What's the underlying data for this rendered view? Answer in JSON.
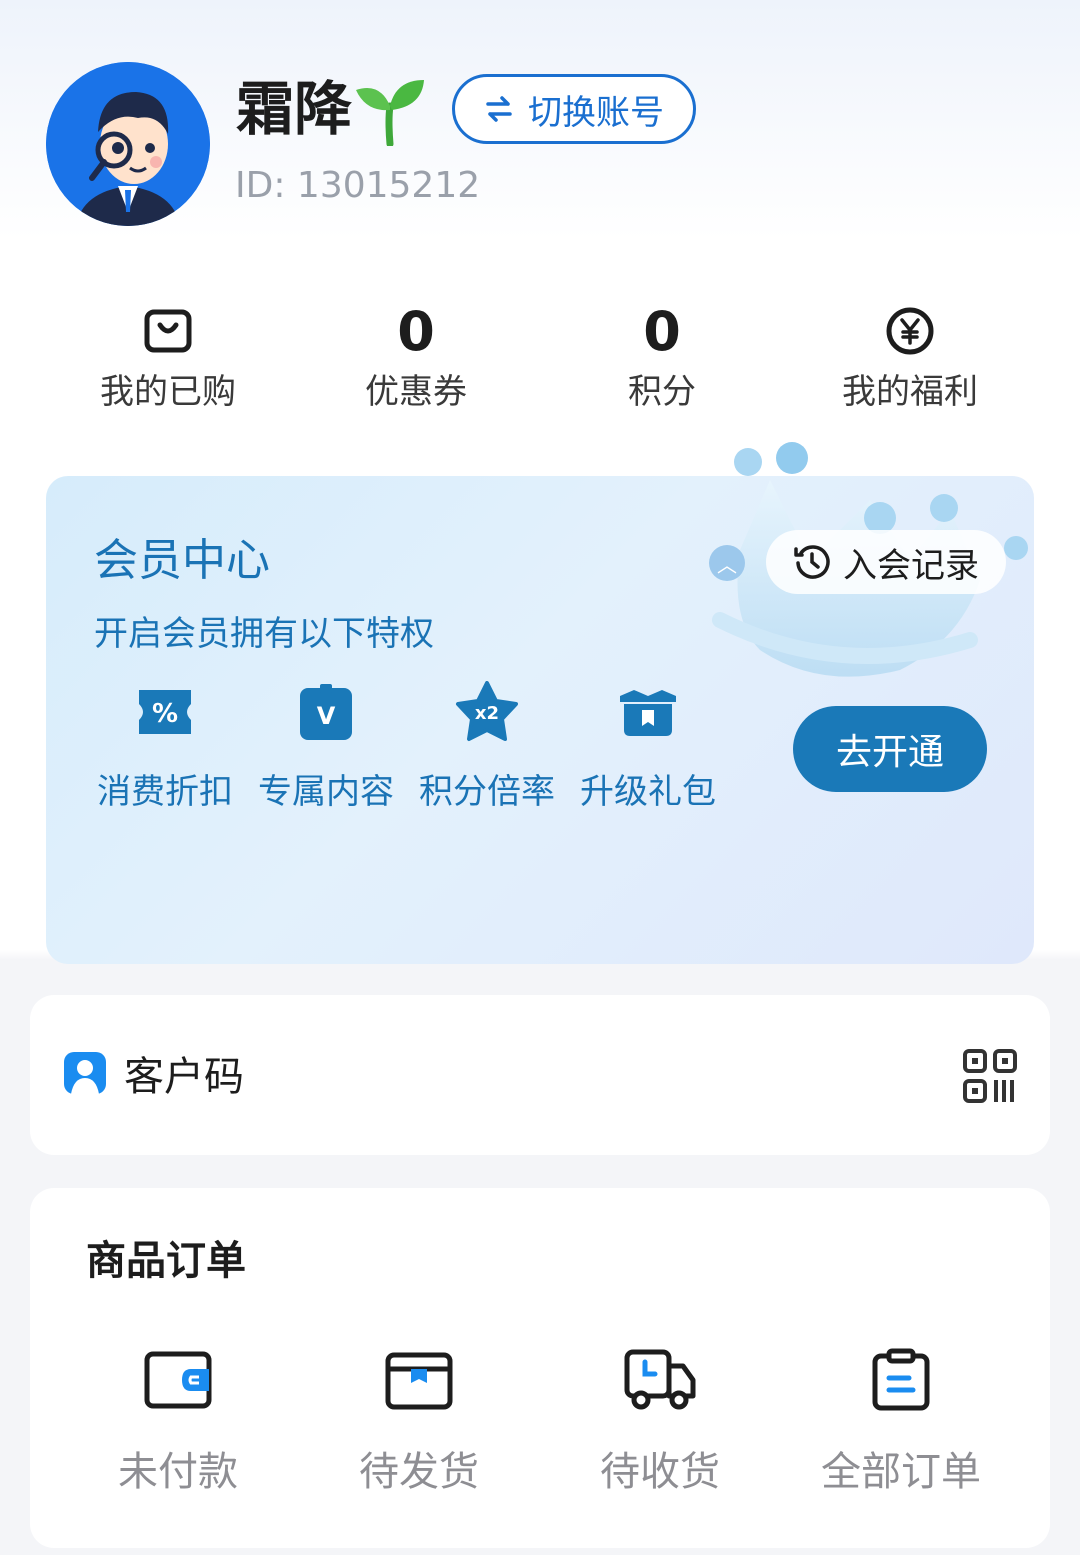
{
  "profile": {
    "name": "霜降",
    "id_text": "ID: 13015212",
    "switch_label": "切换账号"
  },
  "stats": [
    {
      "value": "",
      "icon": "bag-icon",
      "label": "我的已购"
    },
    {
      "value": "0",
      "label": "优惠券"
    },
    {
      "value": "0",
      "label": "积分"
    },
    {
      "value": "",
      "icon": "yen-circle-icon",
      "label": "我的福利"
    }
  ],
  "member": {
    "title": "会员中心",
    "subtitle": "开启会员拥有以下特权",
    "record_label": "入会记录",
    "open_label": "去开通",
    "perks": [
      {
        "label": "消费折扣",
        "icon": "discount-ticket-icon",
        "glyph": "%"
      },
      {
        "label": "专属内容",
        "icon": "exclusive-content-icon",
        "glyph": "V"
      },
      {
        "label": "积分倍率",
        "icon": "points-multiplier-icon",
        "glyph": "x2"
      },
      {
        "label": "升级礼包",
        "icon": "gift-box-icon",
        "glyph": ""
      }
    ],
    "accent_color": "#1a73b5"
  },
  "customer_code": {
    "label": "客户码"
  },
  "orders": {
    "title": "商品订单",
    "items": [
      {
        "label": "未付款",
        "icon": "wallet-icon"
      },
      {
        "label": "待发货",
        "icon": "package-icon"
      },
      {
        "label": "待收货",
        "icon": "delivery-truck-icon"
      },
      {
        "label": "全部订单",
        "icon": "clipboard-icon"
      }
    ]
  }
}
